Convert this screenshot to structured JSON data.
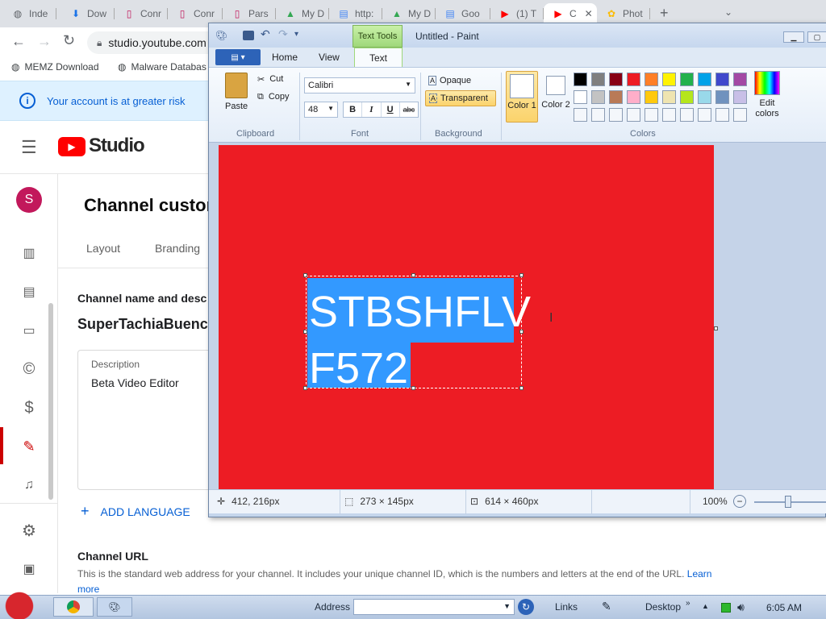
{
  "browser": {
    "tabs": [
      {
        "label": "Inde",
        "icon": "globe-icon"
      },
      {
        "label": "Dow",
        "icon": "download-icon"
      },
      {
        "label": "Conr",
        "icon": "bookmark-icon"
      },
      {
        "label": "Conr",
        "icon": "bookmark-icon"
      },
      {
        "label": "Pars",
        "icon": "bookmark-icon"
      },
      {
        "label": "My D",
        "icon": "drive-icon"
      },
      {
        "label": "http:",
        "icon": "docs-icon"
      },
      {
        "label": "My D",
        "icon": "drive-icon"
      },
      {
        "label": "Goo",
        "icon": "docs-icon"
      },
      {
        "label": "(1) T",
        "icon": "youtube-icon"
      },
      {
        "label": "C",
        "icon": "youtube-icon"
      },
      {
        "label": "Phot",
        "icon": "photos-icon"
      }
    ],
    "new_tab": "+",
    "address": "studio.youtube.com",
    "bookmarks": [
      {
        "label": "MEMZ Download"
      },
      {
        "label": "Malware Databas"
      }
    ]
  },
  "studio": {
    "banner_text": "Your account is at greater risk",
    "logo_text": "Studio",
    "avatar_letter": "S",
    "page_title": "Channel custon",
    "tabs": [
      "Layout",
      "Branding"
    ],
    "section_title": "Channel name and desc",
    "channel_name": "SuperTachiaBuenc",
    "description_label": "Description",
    "description_value": "Beta Video Editor",
    "add_language": "ADD LANGUAGE",
    "url_title": "Channel URL",
    "url_text": "This is the standard web address for your channel. It includes your unique channel ID, which is the numbers and letters at the end of the URL.",
    "url_link": "Learn",
    "url_more": "more"
  },
  "paint": {
    "title": "Untitled - Paint",
    "context_tab": "Text Tools",
    "tabs": [
      "Home",
      "View",
      "Text"
    ],
    "clipboard": {
      "paste": "Paste",
      "cut": "Cut",
      "copy": "Copy",
      "label": "Clipboard"
    },
    "font": {
      "family": "Calibri",
      "size": "48",
      "label": "Font",
      "bold": "B",
      "italic": "I",
      "underline": "U",
      "strike": "abc"
    },
    "background": {
      "opaque": "Opaque",
      "transparent": "Transparent",
      "label": "Background"
    },
    "colors": {
      "color1": "Color 1",
      "color2": "Color 2",
      "label": "Colors",
      "edit": "Edit colors",
      "row1": [
        "#000000",
        "#7f7f7f",
        "#880015",
        "#ed1c24",
        "#ff7f27",
        "#fff200",
        "#22b14c",
        "#00a2e8",
        "#3f48cc",
        "#a349a4"
      ],
      "row2": [
        "#ffffff",
        "#c3c3c3",
        "#b97a57",
        "#ffaec9",
        "#ffc90e",
        "#efe4b0",
        "#b5e61d",
        "#99d9ea",
        "#7092be",
        "#c8bfe7"
      ]
    },
    "canvas_color": "#ed1c24",
    "text_line1": "STBSHFLV",
    "text_line2": "F572",
    "status": {
      "cursor": "412, 216px",
      "selection": "273 × 145px",
      "size": "614 × 460px",
      "zoom": "100%"
    }
  },
  "taskbar": {
    "address_label": "Address",
    "links_label": "Links",
    "desktop_label": "Desktop",
    "time": "6:05 AM"
  }
}
